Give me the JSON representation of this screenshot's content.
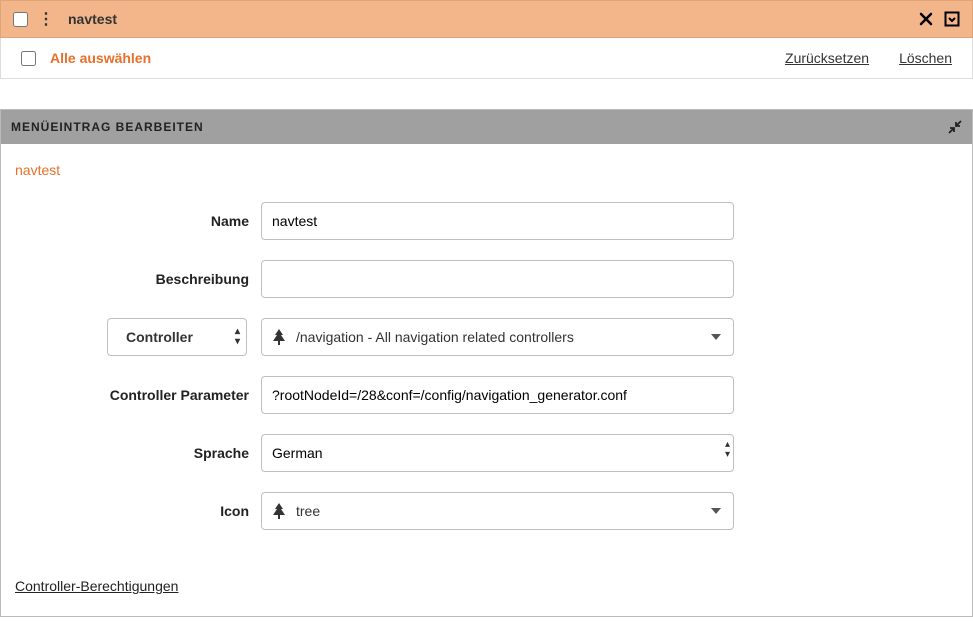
{
  "topbar": {
    "title": "navtest"
  },
  "selectRow": {
    "select_all": "Alle auswählen",
    "reset": "Zurücksetzen",
    "delete": "Löschen"
  },
  "panel": {
    "header": "MENÜEINTRAG BEARBEITEN",
    "crumb": "navtest",
    "labels": {
      "name": "Name",
      "description": "Beschreibung",
      "controller": "Controller",
      "controller_param": "Controller Parameter",
      "language": "Sprache",
      "icon": "Icon"
    },
    "values": {
      "name": "navtest",
      "description": "",
      "controller_display": "/navigation - All navigation related controllers",
      "controller_param": "?rootNodeId=/28&conf=/config/navigation_generator.conf",
      "language": "German",
      "icon": "tree"
    },
    "perm_link": "Controller-Berechtigungen"
  }
}
